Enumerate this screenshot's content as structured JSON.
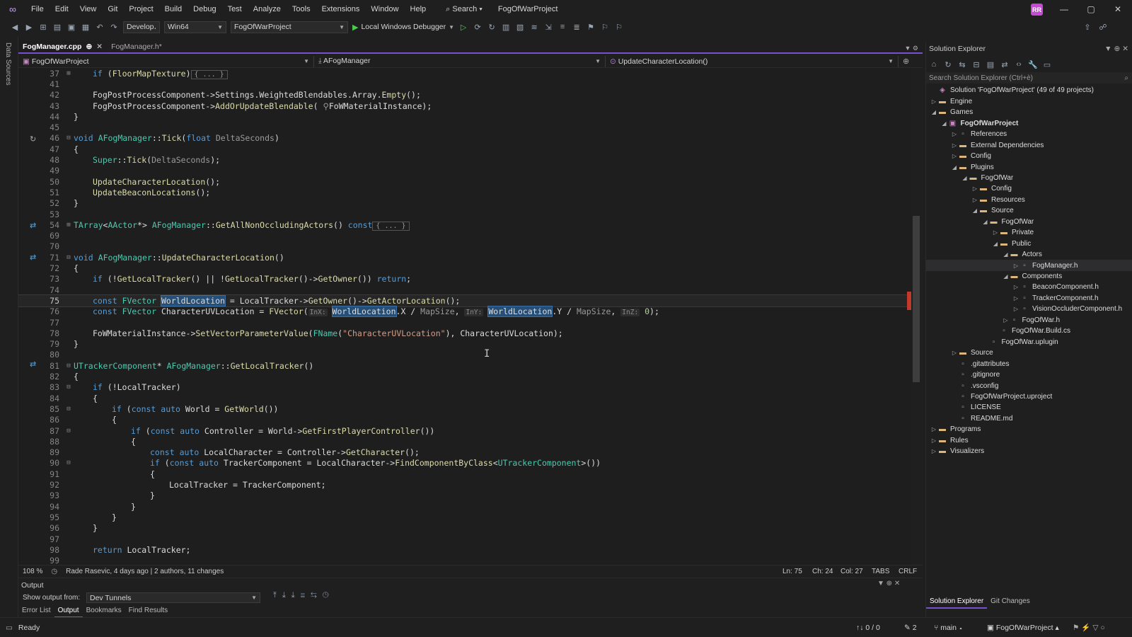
{
  "window": {
    "menu": [
      "File",
      "Edit",
      "View",
      "Git",
      "Project",
      "Build",
      "Debug",
      "Test",
      "Analyze",
      "Tools",
      "Extensions",
      "Window",
      "Help"
    ],
    "search_label": "Search",
    "project_title": "FogOfWarProject",
    "avatar_initials": "RR",
    "minimize_glyph": "—",
    "maximize_glyph": "▢",
    "close_glyph": "✕"
  },
  "toolbar": {
    "config": "Develop․",
    "platform": "Win64",
    "startup_project": "FogOfWarProject",
    "debugger": "Local Windows Debugger"
  },
  "left_strip_label": "Data Sources",
  "tabs": [
    {
      "label": "FogManager.cpp",
      "pin": "⊕",
      "close": "✕",
      "active": true
    },
    {
      "label": "FogManager.h*",
      "active": false
    }
  ],
  "navbar": {
    "project": "FogOfWarProject",
    "scope": "AFogManager",
    "member": "UpdateCharacterLocation()"
  },
  "editor": {
    "current_line": "75",
    "lines": [
      {
        "n": "37",
        "fold": "⊞",
        "html": "<span class='kw'>if</span> (<span class='fn'>FloorMapTexture</span>)<span class='coll'>{ ... }</span>",
        "indent": 1
      },
      {
        "n": "41",
        "html": "",
        "indent": 0
      },
      {
        "n": "42",
        "html": "FogPostProcessComponent-&gt;Settings.WeightedBlendables.Array.<span class='fn'>Empty</span>();",
        "indent": 1
      },
      {
        "n": "43",
        "html": "FogPostProcessComponent-&gt;<span class='fn'>AddOrUpdateBlendable</span>( <span class='pm'>⚲</span>FoWMaterialInstance);",
        "indent": 1
      },
      {
        "n": "44",
        "html": "}",
        "indent": 0
      },
      {
        "n": "45",
        "html": "",
        "indent": 0
      },
      {
        "n": "46",
        "fold": "⊟",
        "html": "<span class='kw'>void</span> <span class='ty'>AFogManager</span>::<span class='fn'>Tick</span>(<span class='kw'>float</span> <span class='pm'>DeltaSeconds</span>)",
        "indent": 0
      },
      {
        "n": "47",
        "html": "{",
        "indent": 0
      },
      {
        "n": "48",
        "html": "<span class='ty'>Super</span>::<span class='fn'>Tick</span>(<span class='pm'>DeltaSeconds</span>);",
        "indent": 1
      },
      {
        "n": "49",
        "html": "",
        "indent": 0
      },
      {
        "n": "50",
        "html": "<span class='fn'>UpdateCharacterLocation</span>();",
        "indent": 1
      },
      {
        "n": "51",
        "html": "<span class='fn'>UpdateBeaconLocations</span>();",
        "indent": 1
      },
      {
        "n": "52",
        "html": "}",
        "indent": 0
      },
      {
        "n": "53",
        "html": "",
        "indent": 0
      },
      {
        "n": "54",
        "fold": "⊞",
        "html": "<span class='ty'>TArray</span>&lt;<span class='ty'>AActor</span>*&gt; <span class='ty'>AFogManager</span>::<span class='fn'>GetAllNonOccludingActors</span>() <span class='kw'>const</span><span class='coll'>{ ... }</span>",
        "indent": 0
      },
      {
        "n": "69",
        "html": "",
        "indent": 0
      },
      {
        "n": "70",
        "html": "",
        "indent": 0
      },
      {
        "n": "71",
        "fold": "⊟",
        "html": "<span class='kw'>void</span> <span class='ty'>AFogManager</span>::<span class='fn'>UpdateCharacterLocation</span>()",
        "indent": 0
      },
      {
        "n": "72",
        "html": "{",
        "indent": 0
      },
      {
        "n": "73",
        "html": "<span class='kw'>if</span> (!<span class='fn'>GetLocalTracker</span>() || !<span class='fn'>GetLocalTracker</span>()-&gt;<span class='fn'>GetOwner</span>()) <span class='kw'>return</span>;",
        "indent": 1
      },
      {
        "n": "74",
        "html": "",
        "indent": 0
      },
      {
        "n": "75",
        "html": "<span class='kw'>const</span> <span class='ty'>FVector</span> <span class='hl'>WorldLocation</span> = LocalTracker-&gt;<span class='fn'>GetOwner</span>()-&gt;<span class='fn'>GetActorLocation</span>();",
        "indent": 1,
        "cur": true
      },
      {
        "n": "76",
        "html": "<span class='kw'>const</span> <span class='ty'>FVector</span> CharacterUVLocation = <span class='fn'>FVector</span>(<span class='hint'>InX:</span> <span class='hl'>WorldLocation</span>.X / <span class='pm'>MapSize</span>, <span class='hint'>InY:</span> <span class='hl'>WorldLocation</span>.Y / <span class='pm'>MapSize</span>, <span class='hint'>InZ:</span> <span class='nu'>0</span>);",
        "indent": 1
      },
      {
        "n": "77",
        "html": "",
        "indent": 0
      },
      {
        "n": "78",
        "html": "FoWMaterialInstance-&gt;<span class='fn'>SetVectorParameterValue</span>(<span class='ty'>FName</span>(<span class='st'>\"CharacterUVLocation\"</span>), CharacterUVLocation);",
        "indent": 1
      },
      {
        "n": "79",
        "html": "}",
        "indent": 0
      },
      {
        "n": "80",
        "html": "",
        "indent": 0
      },
      {
        "n": "81",
        "fold": "⊟",
        "html": "<span class='ty'>UTrackerComponent</span>* <span class='ty'>AFogManager</span>::<span class='fn'>GetLocalTracker</span>()",
        "indent": 0
      },
      {
        "n": "82",
        "html": "{",
        "indent": 0
      },
      {
        "n": "83",
        "fold": "⊟",
        "html": "<span class='kw'>if</span> (!LocalTracker)",
        "indent": 1
      },
      {
        "n": "84",
        "html": "{",
        "indent": 1
      },
      {
        "n": "85",
        "fold": "⊟",
        "html": "<span class='kw'>if</span> (<span class='kw'>const</span> <span class='kw'>auto</span> World = <span class='fn'>GetWorld</span>())",
        "indent": 2
      },
      {
        "n": "86",
        "html": "{",
        "indent": 2
      },
      {
        "n": "87",
        "fold": "⊟",
        "html": "<span class='kw'>if</span> (<span class='kw'>const</span> <span class='kw'>auto</span> Controller = World-&gt;<span class='fn'>GetFirstPlayerController</span>())",
        "indent": 3
      },
      {
        "n": "88",
        "html": "{",
        "indent": 3
      },
      {
        "n": "89",
        "html": "<span class='kw'>const</span> <span class='kw'>auto</span> LocalCharacter = Controller-&gt;<span class='fn'>GetCharacter</span>();",
        "indent": 4
      },
      {
        "n": "90",
        "fold": "⊟",
        "html": "<span class='kw'>if</span> (<span class='kw'>const</span> <span class='kw'>auto</span> TrackerComponent = LocalCharacter-&gt;<span class='fn'>FindComponentByClass</span>&lt;<span class='ty'>UTrackerComponent</span>&gt;())",
        "indent": 4
      },
      {
        "n": "91",
        "html": "{",
        "indent": 4
      },
      {
        "n": "92",
        "html": "LocalTracker = TrackerComponent;",
        "indent": 5
      },
      {
        "n": "93",
        "html": "}",
        "indent": 4
      },
      {
        "n": "94",
        "html": "}",
        "indent": 3
      },
      {
        "n": "95",
        "html": "}",
        "indent": 2
      },
      {
        "n": "96",
        "html": "}",
        "indent": 1
      },
      {
        "n": "97",
        "html": "",
        "indent": 0
      },
      {
        "n": "98",
        "html": "<span class='kw'>return</span> LocalTracker;",
        "indent": 1
      },
      {
        "n": "99",
        "html": "",
        "indent": 0
      }
    ]
  },
  "editor_status": {
    "zoom": "108 %",
    "git_blame": "Rade Rasevic, 4 days ago | 2 authors, 11 changes",
    "ln": "Ln: 75",
    "ch": "Ch: 24",
    "col": "Col: 27",
    "tabs": "TABS",
    "eol": "CRLF"
  },
  "output": {
    "title": "Output",
    "show_from_label": "Show output from:",
    "source": "Dev Tunnels",
    "tabs": [
      "Error List",
      "Output",
      "Bookmarks",
      "Find Results"
    ]
  },
  "solution_explorer": {
    "title": "Solution Explorer",
    "search_placeholder": "Search Solution Explorer (Ctrl+è)",
    "items": [
      {
        "label": "Solution 'FogOfWarProject' (49 of 49 projects)",
        "depth": 0,
        "icon": "sln",
        "tw": ""
      },
      {
        "label": "Engine",
        "depth": 0,
        "icon": "folder",
        "tw": "▷"
      },
      {
        "label": "Games",
        "depth": 0,
        "icon": "folder",
        "tw": "◢"
      },
      {
        "label": "FogOfWarProject",
        "depth": 1,
        "icon": "proj",
        "tw": "◢",
        "bold": true
      },
      {
        "label": "References",
        "depth": 2,
        "icon": "file",
        "tw": "▷"
      },
      {
        "label": "External Dependencies",
        "depth": 2,
        "icon": "folder",
        "tw": "▷"
      },
      {
        "label": "Config",
        "depth": 2,
        "icon": "folder",
        "tw": "▷"
      },
      {
        "label": "Plugins",
        "depth": 2,
        "icon": "folder",
        "tw": "◢"
      },
      {
        "label": "FogOfWar",
        "depth": 3,
        "icon": "folder",
        "tw": "◢"
      },
      {
        "label": "Config",
        "depth": 4,
        "icon": "folder",
        "tw": "▷"
      },
      {
        "label": "Resources",
        "depth": 4,
        "icon": "folder",
        "tw": "▷"
      },
      {
        "label": "Source",
        "depth": 4,
        "icon": "folder",
        "tw": "◢"
      },
      {
        "label": "FogOfWar",
        "depth": 5,
        "icon": "folder",
        "tw": "◢"
      },
      {
        "label": "Private",
        "depth": 6,
        "icon": "folder",
        "tw": "▷"
      },
      {
        "label": "Public",
        "depth": 6,
        "icon": "folder",
        "tw": "◢"
      },
      {
        "label": "Actors",
        "depth": 7,
        "icon": "folder",
        "tw": "◢"
      },
      {
        "label": "FogManager.h",
        "depth": 8,
        "icon": "file",
        "tw": "▷",
        "sel": true
      },
      {
        "label": "Components",
        "depth": 7,
        "icon": "folder",
        "tw": "◢"
      },
      {
        "label": "BeaconComponent.h",
        "depth": 8,
        "icon": "file",
        "tw": "▷"
      },
      {
        "label": "TrackerComponent.h",
        "depth": 8,
        "icon": "file",
        "tw": "▷"
      },
      {
        "label": "VisionOccluderComponent.h",
        "depth": 8,
        "icon": "file",
        "tw": "▷"
      },
      {
        "label": "FogOfWar.h",
        "depth": 7,
        "icon": "file",
        "tw": "▷"
      },
      {
        "label": "FogOfWar.Build.cs",
        "depth": 6,
        "icon": "file",
        "tw": ""
      },
      {
        "label": "FogOfWar.uplugin",
        "depth": 5,
        "icon": "file",
        "tw": ""
      },
      {
        "label": "Source",
        "depth": 2,
        "icon": "folder",
        "tw": "▷"
      },
      {
        "label": ".gitattributes",
        "depth": 2,
        "icon": "file",
        "tw": ""
      },
      {
        "label": ".gitignore",
        "depth": 2,
        "icon": "file",
        "tw": ""
      },
      {
        "label": ".vsconfig",
        "depth": 2,
        "icon": "file",
        "tw": ""
      },
      {
        "label": "FogOfWarProject.uproject",
        "depth": 2,
        "icon": "file",
        "tw": ""
      },
      {
        "label": "LICENSE",
        "depth": 2,
        "icon": "file",
        "tw": ""
      },
      {
        "label": "README.md",
        "depth": 2,
        "icon": "file",
        "tw": ""
      },
      {
        "label": "Programs",
        "depth": 0,
        "icon": "folder",
        "tw": "▷"
      },
      {
        "label": "Rules",
        "depth": 0,
        "icon": "folder",
        "tw": "▷"
      },
      {
        "label": "Visualizers",
        "depth": 0,
        "icon": "folder",
        "tw": "▷"
      }
    ],
    "bottom_tabs": [
      "Solution Explorer",
      "Git Changes"
    ]
  },
  "app_status": {
    "ready": "Ready",
    "changes": "↑↓ 0 / 0",
    "edits": "2",
    "branch": "main",
    "repo": "FogOfWarProject"
  }
}
